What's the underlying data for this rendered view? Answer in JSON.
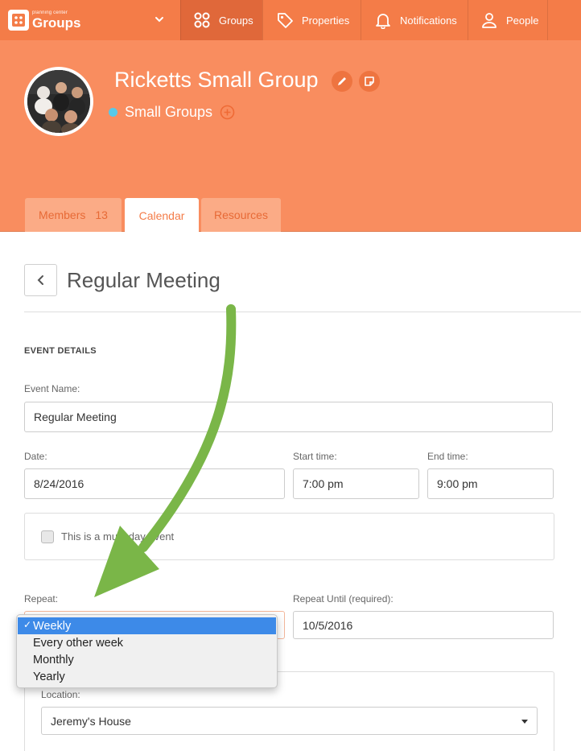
{
  "app": {
    "brand_small": "planning center",
    "brand_name": "Groups"
  },
  "nav": {
    "groups": "Groups",
    "properties": "Properties",
    "notifications": "Notifications",
    "people": "People"
  },
  "group": {
    "name": "Ricketts Small Group",
    "type": "Small Groups"
  },
  "tabs": {
    "members_label": "Members",
    "members_count": "13",
    "calendar_label": "Calendar",
    "resources_label": "Resources"
  },
  "page": {
    "title": "Regular Meeting",
    "section_title": "EVENT DETAILS"
  },
  "form": {
    "event_name_label": "Event Name:",
    "event_name_value": "Regular Meeting",
    "date_label": "Date:",
    "date_value": "8/24/2016",
    "start_time_label": "Start time:",
    "start_time_value": "7:00 pm",
    "end_time_label": "End time:",
    "end_time_value": "9:00 pm",
    "multi_day_label": "This is a multi-day event",
    "repeat_label": "Repeat:",
    "repeat_until_label": "Repeat Until (required):",
    "repeat_until_value": "10/5/2016",
    "location_label": "Location:",
    "location_value": "Jeremy's House"
  },
  "repeat_dropdown": {
    "selected": "Weekly",
    "options": [
      "Weekly",
      "Every other week",
      "Monthly",
      "Yearly"
    ]
  },
  "colors": {
    "brand": "#f47c48",
    "header": "#f98d5f",
    "dropdown_highlight": "#3d8ae8",
    "annotation_arrow": "#7ab648",
    "type_dot": "#57c9e8"
  }
}
